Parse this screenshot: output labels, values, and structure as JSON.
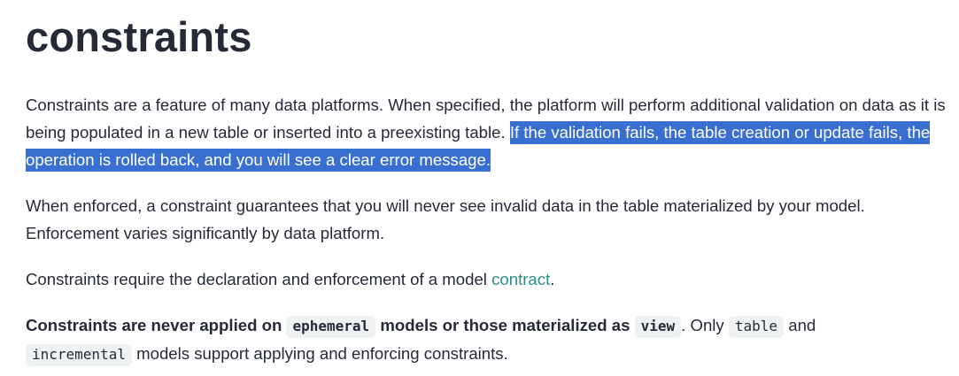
{
  "heading": "constraints",
  "para1": {
    "plain": "Constraints are a feature of many data platforms. When specified, the platform will perform additional validation on data as it is being populated in a new table or inserted into a preexisting table. ",
    "selected": "If the validation fails, the table creation or update fails, the operation is rolled back, and you will see a clear error message."
  },
  "para2": "When enforced, a constraint guarantees that you will never see invalid data in the table materialized by your model. Enforcement varies significantly by data platform.",
  "para3": {
    "before": "Constraints require the declaration and enforcement of a model ",
    "link": "contract",
    "after": "."
  },
  "para4": {
    "bold1": "Constraints are never applied on ",
    "code1": "ephemeral",
    "bold2": " models or those materialized as ",
    "code2": "view",
    "text1": ". Only ",
    "code3": "table",
    "text2": " and ",
    "code4": "incremental",
    "text3": " models support applying and enforcing constraints."
  },
  "colors": {
    "text": "#262a38",
    "selection": "#3a6fd2",
    "link": "#2a8f86",
    "code_bg": "#eff2f3"
  }
}
